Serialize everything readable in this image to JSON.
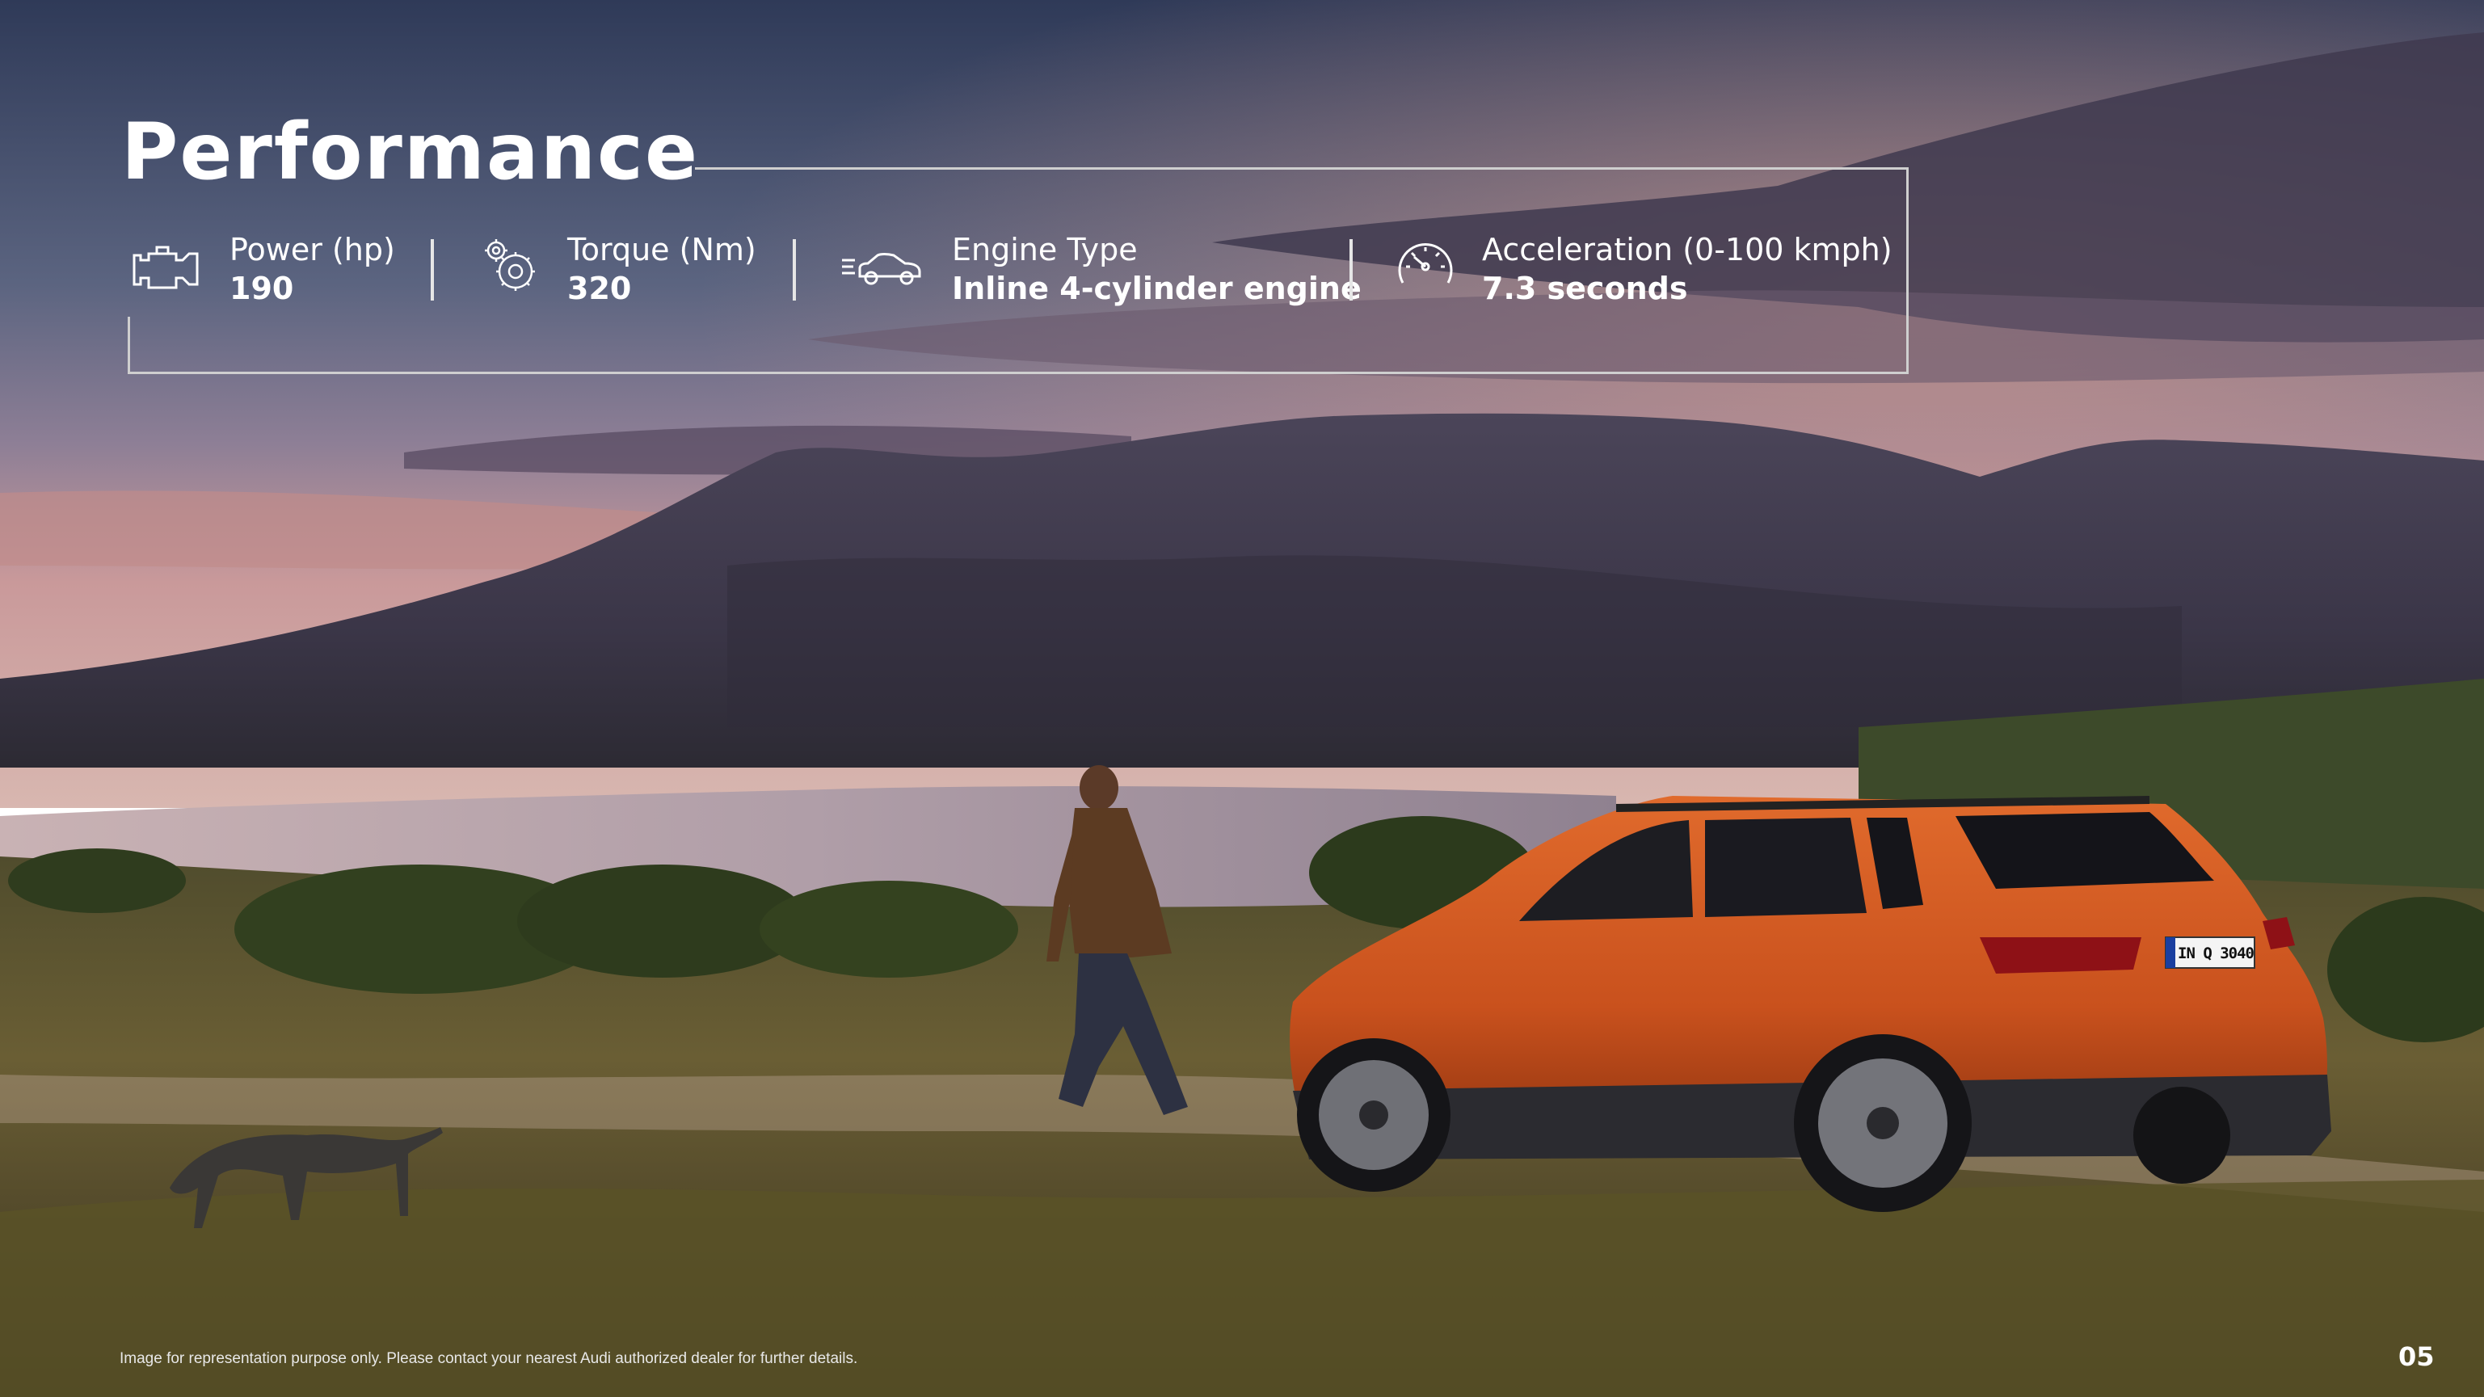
{
  "page": {
    "title": "Performance",
    "page_number": "05",
    "disclaimer": "Image for representation purpose only. Please contact your nearest Audi authorized  dealer for further details."
  },
  "stats": [
    {
      "icon": "engine-icon",
      "label": "Power (hp)",
      "value": "190"
    },
    {
      "icon": "torque-gear-icon",
      "label": "Torque (Nm)",
      "value": "320"
    },
    {
      "icon": "car-speed-icon",
      "label": "Engine Type",
      "value": "Inline 4-cylinder engine"
    },
    {
      "icon": "speedometer-icon",
      "label": "Acceleration (0-100 kmph)",
      "value": "7.3 seconds"
    }
  ],
  "vehicle": {
    "license_plate": "IN Q 3040",
    "body_color": "#d2541d"
  },
  "colors": {
    "sky_top": "#3c4866",
    "sunset_pink": "#c08587",
    "mountain": "#423e52",
    "lake": "#b7a4ad",
    "grass": "#5c5a2c"
  }
}
